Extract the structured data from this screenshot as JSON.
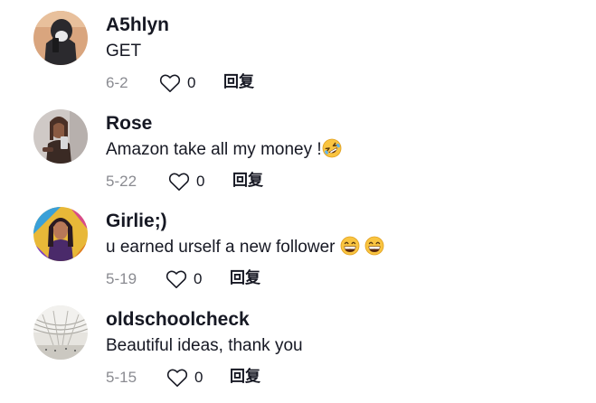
{
  "comments": [
    {
      "username": "A5hlyn",
      "text": "GET",
      "date": "6-2",
      "likes": "0",
      "reply_label": "回复",
      "avatar_icon": "avatar-masked-person"
    },
    {
      "username": "Rose",
      "text": "Amazon take all my money !",
      "emojis": [
        "rolling-on-floor-laughing-emoji"
      ],
      "date": "5-22",
      "likes": "0",
      "reply_label": "回复",
      "avatar_icon": "avatar-mirror-selfie"
    },
    {
      "username": "Girlie;)",
      "text": "u earned urself a new follower ",
      "emojis": [
        "grinning-face-emoji",
        "grinning-face-emoji"
      ],
      "date": "5-19",
      "likes": "0",
      "reply_label": "回复",
      "avatar_icon": "avatar-colorful-portrait"
    },
    {
      "username": "oldschoolcheck",
      "text": "Beautiful ideas, thank you",
      "date": "5-15",
      "likes": "0",
      "reply_label": "回复",
      "avatar_icon": "avatar-architecture-photo"
    }
  ],
  "colors": {
    "text_primary": "#161823",
    "text_secondary": "#8a8b91",
    "background": "#ffffff"
  }
}
